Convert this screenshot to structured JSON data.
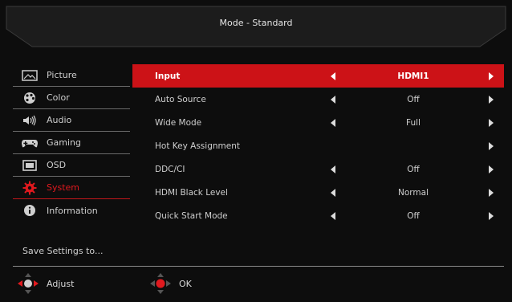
{
  "header": {
    "title": "Mode - Standard"
  },
  "sidebar": {
    "items": [
      {
        "label": "Picture",
        "icon": "picture-icon"
      },
      {
        "label": "Color",
        "icon": "color-palette-icon"
      },
      {
        "label": "Audio",
        "icon": "speaker-icon"
      },
      {
        "label": "Gaming",
        "icon": "gamepad-icon"
      },
      {
        "label": "OSD",
        "icon": "osd-icon"
      },
      {
        "label": "System",
        "icon": "gear-icon",
        "active": true
      },
      {
        "label": "Information",
        "icon": "info-icon"
      }
    ],
    "save_label": "Save Settings to..."
  },
  "settings": [
    {
      "label": "Input",
      "value": "HDMI1",
      "selected": true,
      "arrows": "both"
    },
    {
      "label": "Auto Source",
      "value": "Off",
      "arrows": "both"
    },
    {
      "label": "Wide Mode",
      "value": "Full",
      "arrows": "both"
    },
    {
      "label": "Hot Key Assignment",
      "value": "",
      "arrows": "right"
    },
    {
      "label": "DDC/CI",
      "value": "Off",
      "arrows": "both"
    },
    {
      "label": "HDMI Black Level",
      "value": "Normal",
      "arrows": "both"
    },
    {
      "label": "Quick Start Mode",
      "value": "Off",
      "arrows": "both"
    }
  ],
  "footer": {
    "adjust_label": "Adjust",
    "ok_label": "OK"
  },
  "colors": {
    "accent": "#cc1217",
    "background": "#0d0d0d"
  }
}
